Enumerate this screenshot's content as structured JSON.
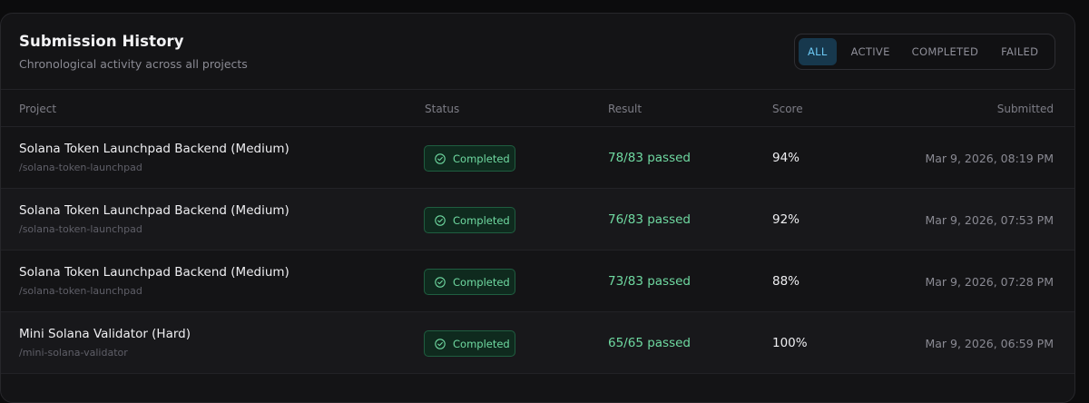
{
  "header": {
    "title": "Submission History",
    "subtitle": "Chronological activity across all projects"
  },
  "filters": [
    {
      "label": "ALL",
      "active": true
    },
    {
      "label": "ACTIVE",
      "active": false
    },
    {
      "label": "COMPLETED",
      "active": false
    },
    {
      "label": "FAILED",
      "active": false
    }
  ],
  "columns": {
    "project": "Project",
    "status": "Status",
    "result": "Result",
    "score": "Score",
    "submitted": "Submitted"
  },
  "rows": [
    {
      "name": "Solana Token Launchpad Backend (Medium)",
      "slug": "/solana-token-launchpad",
      "status": "Completed",
      "result": "78/83 passed",
      "score": "94%",
      "submitted": "Mar 9, 2026, 08:19 PM"
    },
    {
      "name": "Solana Token Launchpad Backend (Medium)",
      "slug": "/solana-token-launchpad",
      "status": "Completed",
      "result": "76/83 passed",
      "score": "92%",
      "submitted": "Mar 9, 2026, 07:53 PM"
    },
    {
      "name": "Solana Token Launchpad Backend (Medium)",
      "slug": "/solana-token-launchpad",
      "status": "Completed",
      "result": "73/83 passed",
      "score": "88%",
      "submitted": "Mar 9, 2026, 07:28 PM"
    },
    {
      "name": "Mini Solana Validator (Hard)",
      "slug": "/mini-solana-validator",
      "status": "Completed",
      "result": "65/65 passed",
      "score": "100%",
      "submitted": "Mar 9, 2026, 06:59 PM"
    }
  ],
  "colors": {
    "accent": "#6cc7f2",
    "success": "#6fd9a1",
    "background": "#141416"
  }
}
